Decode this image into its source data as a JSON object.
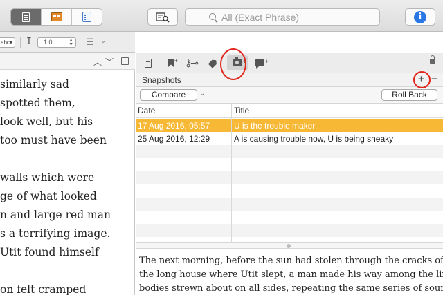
{
  "toolbar": {
    "view_modes": [
      {
        "name": "scrivenings",
        "icon": "document-icon",
        "active": true
      },
      {
        "name": "corkboard",
        "icon": "corkboard-icon",
        "active": false
      },
      {
        "name": "outliner",
        "icon": "outliner-icon",
        "active": false
      }
    ],
    "search_placeholder": "All (Exact Phrase)",
    "info_icon": "i"
  },
  "format_bar": {
    "style_select": "abc",
    "line_spacing": "1.0"
  },
  "editor": {
    "lines": [
      "similarly sad",
      " spotted them,",
      "look well, but his",
      "too must have been",
      "",
      "walls which were",
      "ge of what looked",
      "n and large red man",
      "s a terrifying image.",
      " Utit found himself",
      "",
      "on felt cramped"
    ]
  },
  "inspector": {
    "tabs": [
      "notes",
      "bookmarks",
      "metadata",
      "keywords",
      "snapshots",
      "comments"
    ],
    "snapshots_title": "Snapshots",
    "compare_label": "Compare",
    "rollback_label": "Roll Back",
    "columns": {
      "date": "Date",
      "title": "Title"
    },
    "rows": [
      {
        "date": "17 Aug 2016, 05:57",
        "title": "U is the trouble maker",
        "selected": true
      },
      {
        "date": "25 Aug 2016, 12:29",
        "title": "A is causing trouble now, U is being sneaky",
        "selected": false
      }
    ],
    "snapshot_text": [
      "      The next morning, before the sun had stolen through the cracks of",
      "the long house where Utit slept, a man made his way among the limp",
      "bodies strewn about on all sides, repeating the same series of sounds"
    ]
  },
  "colors": {
    "selection": "#f7b935",
    "annotation": "#e1251b",
    "info_blue": "#2a76e4"
  }
}
